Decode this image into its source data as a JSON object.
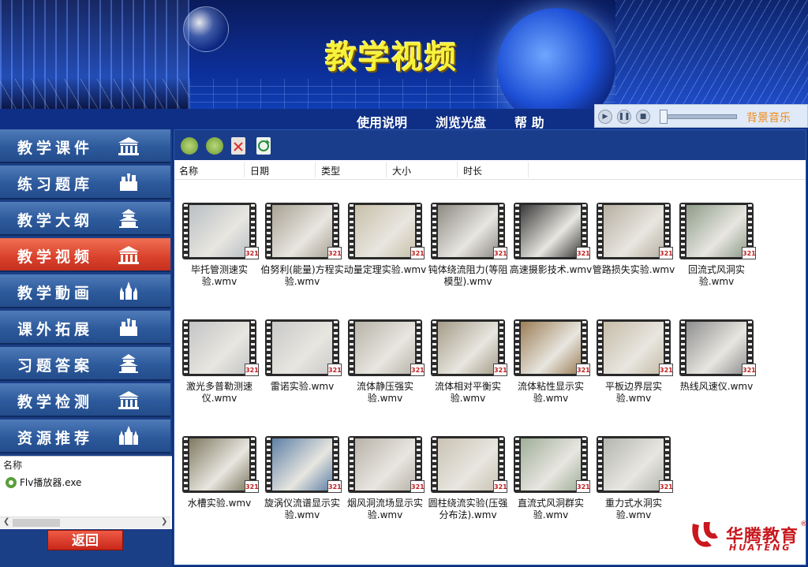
{
  "header": {
    "title": "教学视频",
    "nav": [
      "使用说明",
      "浏览光盘",
      "帮 助"
    ],
    "music_label": "背景音乐"
  },
  "sidebar": {
    "items": [
      {
        "label": "教学课件",
        "icon": "museum-icon",
        "active": false
      },
      {
        "label": "练习题库",
        "icon": "castle-icon",
        "active": false
      },
      {
        "label": "教学大纲",
        "icon": "temple-icon",
        "active": false
      },
      {
        "label": "教学视频",
        "icon": "museum-icon",
        "active": true
      },
      {
        "label": "教学動画",
        "icon": "kremlin-icon",
        "active": false
      },
      {
        "label": "课外拓展",
        "icon": "castle-icon",
        "active": false
      },
      {
        "label": "习题答案",
        "icon": "temple-icon",
        "active": false
      },
      {
        "label": "教学检测",
        "icon": "museum-icon",
        "active": false
      },
      {
        "label": "资源推荐",
        "icon": "cathedral-icon",
        "active": false
      }
    ]
  },
  "filepanel": {
    "header": "名称",
    "items": [
      "Flv播放器.exe"
    ]
  },
  "back_label": "返回",
  "columns": [
    "名称",
    "日期",
    "类型",
    "大小",
    "时长"
  ],
  "files": [
    {
      "name": "毕托管测速实验.wmv",
      "color": "#b9bfc4"
    },
    {
      "name": "伯努利(能量)方程实验.wmv",
      "color": "#a8a294"
    },
    {
      "name": "动量定理实验.wmv",
      "color": "#c7bfa9"
    },
    {
      "name": "钝体绕流阻力(等阻模型).wmv",
      "color": "#8d8b84"
    },
    {
      "name": "高速摄影技术.wmv",
      "color": "#3a3a3a"
    },
    {
      "name": "管路损失实验.wmv",
      "color": "#b7b0a2"
    },
    {
      "name": "回流式风洞实验.wmv",
      "color": "#8e9c8a"
    },
    {
      "name": "激光多普勒测速仪.wmv",
      "color": "#c3c4c6"
    },
    {
      "name": "雷诺实验.wmv",
      "color": "#c9c9c9"
    },
    {
      "name": "流体静压强实验.wmv",
      "color": "#b7b3a8"
    },
    {
      "name": "流体相对平衡实验.wmv",
      "color": "#a49c88"
    },
    {
      "name": "流体粘性显示实验.wmv",
      "color": "#9c7e56"
    },
    {
      "name": "平板边界层实验.wmv",
      "color": "#c6bca8"
    },
    {
      "name": "热线风速仪.wmv",
      "color": "#8f8f90"
    },
    {
      "name": "水槽实验.wmv",
      "color": "#7f7a62"
    },
    {
      "name": "旋涡仪流谱显示实验.wmv",
      "color": "#5d7fa6"
    },
    {
      "name": "烟风洞流场显示实验.wmv",
      "color": "#b8b3aa"
    },
    {
      "name": "圆柱绕流实验(压强分布法).wmv",
      "color": "#c9c3b3"
    },
    {
      "name": "直流式风洞群实验.wmv",
      "color": "#9faf99"
    },
    {
      "name": "重力式水洞实验.wmv",
      "color": "#b4b6b0"
    }
  ],
  "logo": {
    "cn": "华腾教育",
    "en": "HUATENG",
    "mark": "®"
  }
}
